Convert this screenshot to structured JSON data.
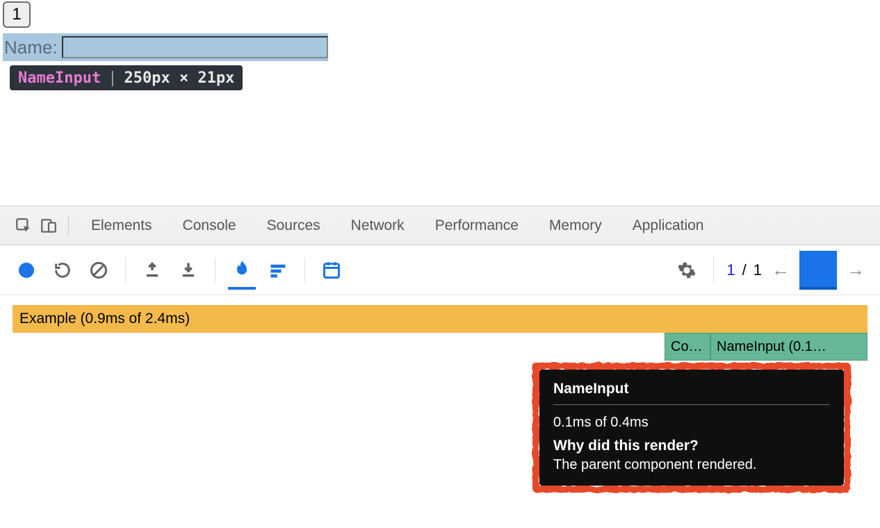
{
  "page": {
    "counter_value": "1",
    "name_label": "Name:",
    "name_value": ""
  },
  "inspector_tag": {
    "component_name": "NameInput",
    "dimensions": "250px × 21px"
  },
  "devtools": {
    "tabs": [
      "Elements",
      "Console",
      "Sources",
      "Network",
      "Performance",
      "Memory",
      "Application"
    ]
  },
  "profiler": {
    "commit_nav": {
      "current": "1",
      "sep": "/",
      "total": "1"
    },
    "flamegraph": {
      "root": "Example (0.9ms of 2.4ms)",
      "child_a": "Co…",
      "child_b": "NameInput (0.1…"
    },
    "tooltip": {
      "title": "NameInput",
      "timing": "0.1ms of 0.4ms",
      "why_heading": "Why did this render?",
      "reason": "The parent component rendered."
    }
  }
}
